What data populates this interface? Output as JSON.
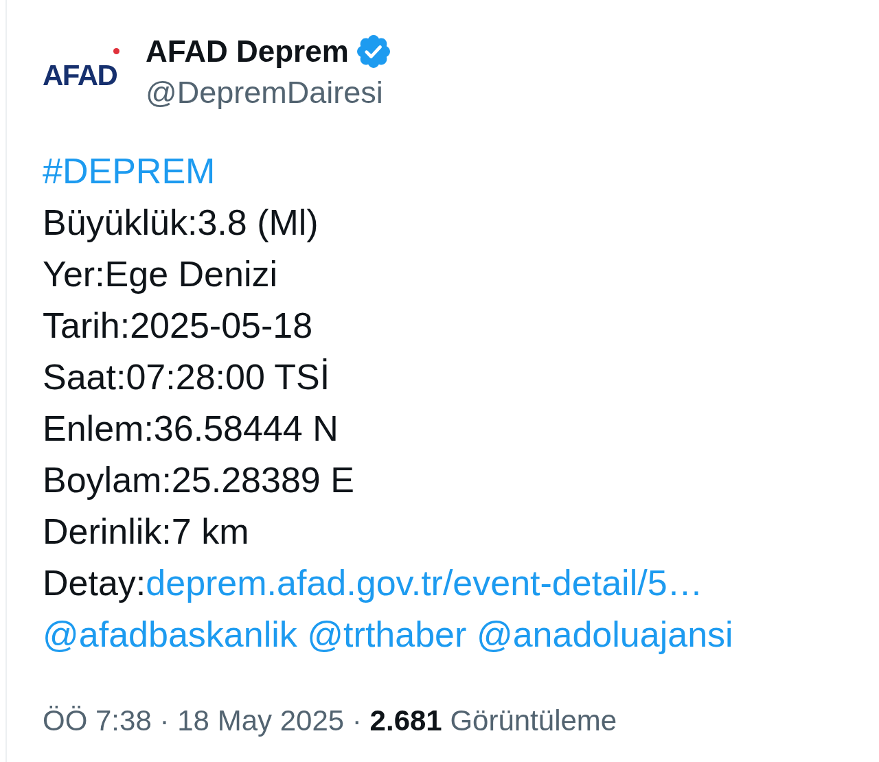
{
  "author": {
    "logo_text": "AFAD",
    "name": "AFAD Deprem",
    "verified": true,
    "handle": "@DepremDairesi"
  },
  "tweet": {
    "lines": [
      {
        "kind": "hashtag",
        "text": "#DEPREM"
      },
      {
        "kind": "text",
        "text": "Büyüklük:3.8 (Ml)"
      },
      {
        "kind": "text",
        "text": "Yer:Ege Denizi"
      },
      {
        "kind": "text",
        "text": "Tarih:2025-05-18"
      },
      {
        "kind": "text",
        "text": "Saat:07:28:00 TSİ"
      },
      {
        "kind": "text",
        "text": "Enlem:36.58444 N"
      },
      {
        "kind": "text",
        "text": "Boylam:25.28389 E"
      },
      {
        "kind": "text",
        "text": "Derinlik:7 km"
      },
      {
        "kind": "link",
        "label": "Detay:",
        "link": "deprem.afad.gov.tr/event-detail/5…"
      },
      {
        "kind": "mentions",
        "mentions": [
          "@afadbaskanlik",
          "@trthaber",
          "@anadoluajansi"
        ]
      }
    ]
  },
  "footer": [
    {
      "kind": "time",
      "text": "ÖÖ 7:38"
    },
    {
      "kind": "separator",
      "text": "·"
    },
    {
      "kind": "date",
      "text": "18 May 2025"
    },
    {
      "kind": "separator",
      "text": "·"
    },
    {
      "kind": "views",
      "text": "**2.681** Görüntüleme"
    }
  ]
}
